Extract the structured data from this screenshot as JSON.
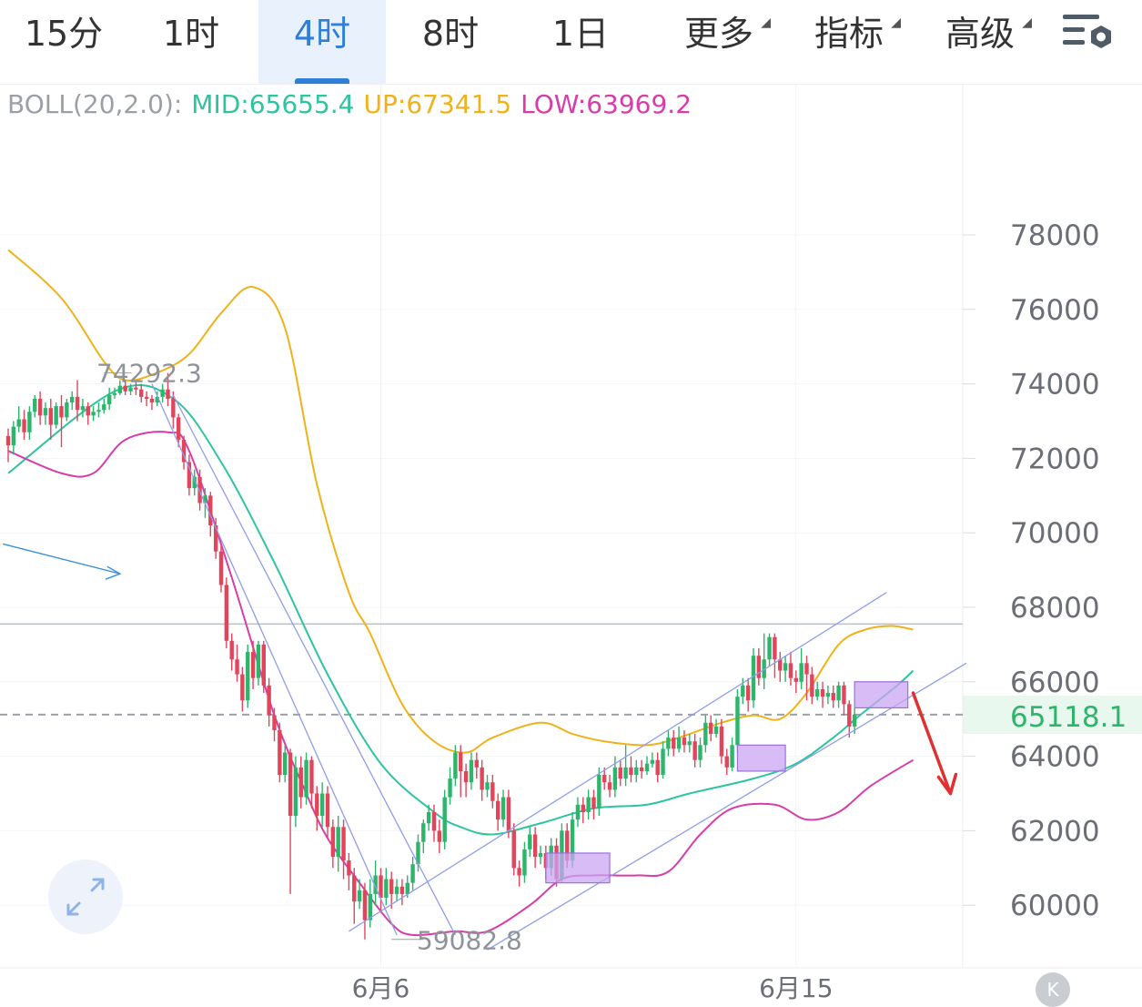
{
  "tabs": [
    {
      "label": "15分"
    },
    {
      "label": "1时"
    },
    {
      "label": "4时",
      "active": true
    },
    {
      "label": "8时"
    },
    {
      "label": "1日"
    },
    {
      "label": "更多"
    },
    {
      "label": "指标"
    },
    {
      "label": "高级"
    }
  ],
  "indicator": {
    "name": "BOLL(20,2.0):",
    "mid": "MID:65655.4",
    "up": "UP:67341.5",
    "low": "LOW:63969.2"
  },
  "colors": {
    "up_candle": "#2cb56b",
    "down_candle": "#e0455c",
    "mid": "#2ec4a0",
    "upper": "#f0b21b",
    "lower": "#d83ca8",
    "accent": "#2f7fd9",
    "trend": "#8f9de8",
    "box": "#c9a6f3",
    "arrow": "#e03131",
    "blue_arrow": "#3a8fd8"
  },
  "icons": {
    "menu": "chart-settings-icon",
    "expand": "expand-icon",
    "scroll": "scroll-to-latest-icon"
  },
  "chart_data": {
    "type": "candlestick",
    "y_ticks": [
      "78000",
      "76000",
      "74000",
      "72000",
      "70000",
      "68000",
      "66000",
      "64000",
      "62000",
      "60000"
    ],
    "y_range": [
      58500,
      79500
    ],
    "x_labels": [
      {
        "text": "6月6",
        "index": 70
      },
      {
        "text": "6月15",
        "index": 148
      }
    ],
    "last_price": "65118.1",
    "high_label": "74292.3",
    "low_label": "59082.8",
    "high_index": 30,
    "low_index": 72,
    "horizontal_level": 67550,
    "candles": [
      [
        72600,
        72350,
        72800,
        71900
      ],
      [
        72350,
        72850,
        73000,
        72100
      ],
      [
        72850,
        73050,
        73400,
        72700
      ],
      [
        73050,
        72700,
        73300,
        72500
      ],
      [
        72700,
        73250,
        73400,
        72500
      ],
      [
        73250,
        73600,
        73700,
        73100
      ],
      [
        73600,
        73150,
        73800,
        72900
      ],
      [
        73150,
        73350,
        73500,
        72900
      ],
      [
        73350,
        72900,
        73600,
        72500
      ],
      [
        72900,
        73400,
        73500,
        72800
      ],
      [
        73400,
        73100,
        73700,
        72300
      ],
      [
        73100,
        73500,
        73600,
        73000
      ],
      [
        73500,
        73650,
        73800,
        73300
      ],
      [
        73650,
        73300,
        74100,
        73000
      ],
      [
        73300,
        73400,
        73600,
        73100
      ],
      [
        73400,
        73150,
        73500,
        72900
      ],
      [
        73150,
        73250,
        73400,
        73000
      ],
      [
        73250,
        73300,
        73500,
        73100
      ],
      [
        73300,
        73450,
        73600,
        73200
      ],
      [
        73450,
        73700,
        73900,
        73300
      ],
      [
        73700,
        73750,
        73900,
        73600
      ],
      [
        73750,
        73950,
        74100,
        73700
      ],
      [
        73950,
        73800,
        74100,
        73700
      ],
      [
        73800,
        73900,
        74000,
        73700
      ],
      [
        73900,
        73850,
        74050,
        73700
      ],
      [
        73850,
        73650,
        74000,
        73500
      ],
      [
        73650,
        73600,
        73800,
        73400
      ],
      [
        73600,
        73500,
        73700,
        73300
      ],
      [
        73500,
        73650,
        73800,
        73400
      ],
      [
        73650,
        73850,
        74000,
        73500
      ],
      [
        73850,
        73600,
        74292,
        73400
      ],
      [
        73600,
        73100,
        73800,
        72800
      ],
      [
        73100,
        72500,
        73200,
        72300
      ],
      [
        72500,
        71900,
        72600,
        71700
      ],
      [
        71900,
        71200,
        72100,
        71000
      ],
      [
        71200,
        71500,
        71700,
        71000
      ],
      [
        71500,
        70800,
        71700,
        70600
      ],
      [
        70800,
        71000,
        71200,
        70400
      ],
      [
        71000,
        70200,
        71100,
        69900
      ],
      [
        70200,
        69500,
        70400,
        69300
      ],
      [
        69500,
        68600,
        69700,
        68400
      ],
      [
        68600,
        67100,
        68800,
        66900
      ],
      [
        67100,
        66600,
        67300,
        66300
      ],
      [
        66600,
        66200,
        67000,
        66000
      ],
      [
        66200,
        65500,
        66400,
        65200
      ],
      [
        65500,
        66800,
        67000,
        65300
      ],
      [
        66800,
        66100,
        67100,
        65800
      ],
      [
        66100,
        67000,
        67100,
        65900
      ],
      [
        67000,
        65900,
        67100,
        65700
      ],
      [
        65900,
        65100,
        66100,
        64800
      ],
      [
        65100,
        64700,
        65300,
        64400
      ],
      [
        64700,
        63500,
        64900,
        63300
      ],
      [
        63500,
        64100,
        64300,
        63300
      ],
      [
        64100,
        62400,
        64200,
        60300
      ],
      [
        62400,
        63700,
        64000,
        62100
      ],
      [
        63700,
        62900,
        64000,
        62600
      ],
      [
        62900,
        63900,
        64100,
        62700
      ],
      [
        63900,
        63000,
        64000,
        62600
      ],
      [
        63000,
        62400,
        63200,
        62000
      ],
      [
        62400,
        63000,
        63300,
        62100
      ],
      [
        63000,
        62100,
        63200,
        61800
      ],
      [
        62100,
        61300,
        62300,
        61000
      ],
      [
        61300,
        62100,
        62400,
        60900
      ],
      [
        62100,
        61200,
        62300,
        60700
      ],
      [
        61200,
        60800,
        61400,
        60400
      ],
      [
        60800,
        60100,
        61000,
        59500
      ],
      [
        60100,
        60400,
        60700,
        59900
      ],
      [
        60400,
        59600,
        60600,
        59082
      ],
      [
        59600,
        60300,
        60700,
        59400
      ],
      [
        60300,
        60800,
        61200,
        60000
      ],
      [
        60800,
        60200,
        61000,
        59800
      ],
      [
        60200,
        60700,
        61000,
        60000
      ],
      [
        60700,
        60300,
        60900,
        59900
      ],
      [
        60300,
        60500,
        60700,
        60100
      ],
      [
        60500,
        60300,
        60700,
        60000
      ],
      [
        60300,
        60600,
        60800,
        60200
      ],
      [
        60600,
        61100,
        61300,
        60400
      ],
      [
        61100,
        61700,
        61900,
        60900
      ],
      [
        61700,
        62200,
        62300,
        61400
      ],
      [
        62200,
        62500,
        62700,
        62000
      ],
      [
        62500,
        62000,
        62700,
        61700
      ],
      [
        62000,
        61700,
        62300,
        61400
      ],
      [
        61700,
        62900,
        63100,
        61500
      ],
      [
        62900,
        63400,
        63700,
        62700
      ],
      [
        63400,
        64100,
        64300,
        63200
      ],
      [
        64100,
        63600,
        64300,
        62900
      ],
      [
        63600,
        63300,
        63800,
        62900
      ],
      [
        63300,
        63900,
        64100,
        63100
      ],
      [
        63900,
        63700,
        64100,
        63400
      ],
      [
        63700,
        63100,
        63900,
        62800
      ],
      [
        63100,
        63300,
        63500,
        62900
      ],
      [
        63300,
        62800,
        63500,
        62600
      ],
      [
        62800,
        62300,
        63000,
        62000
      ],
      [
        62300,
        62900,
        63100,
        62100
      ],
      [
        62900,
        62000,
        63100,
        61800
      ],
      [
        62000,
        61000,
        62200,
        60800
      ],
      [
        61000,
        60800,
        61200,
        60500
      ],
      [
        60800,
        61500,
        61700,
        60600
      ],
      [
        61500,
        61900,
        62100,
        61300
      ],
      [
        61900,
        61300,
        62100,
        61000
      ],
      [
        61300,
        61400,
        61600,
        61100
      ],
      [
        61400,
        61000,
        61600,
        60700
      ],
      [
        61000,
        61600,
        61800,
        60800
      ],
      [
        61600,
        60700,
        61800,
        60500
      ],
      [
        60700,
        62000,
        62200,
        60600
      ],
      [
        62000,
        61200,
        62200,
        61000
      ],
      [
        61200,
        62300,
        62500,
        61000
      ],
      [
        62300,
        62700,
        62900,
        62100
      ],
      [
        62700,
        62500,
        62900,
        62200
      ],
      [
        62500,
        62900,
        63100,
        62300
      ],
      [
        62900,
        62600,
        63100,
        62300
      ],
      [
        62600,
        63500,
        63700,
        62400
      ],
      [
        63500,
        63300,
        63700,
        63100
      ],
      [
        63300,
        63100,
        63500,
        62900
      ],
      [
        63100,
        63700,
        64000,
        62900
      ],
      [
        63700,
        63400,
        63900,
        63200
      ],
      [
        63400,
        63700,
        64300,
        63200
      ],
      [
        63700,
        63500,
        64000,
        63300
      ],
      [
        63500,
        63700,
        63900,
        63300
      ],
      [
        63700,
        63600,
        63900,
        63400
      ],
      [
        63600,
        63800,
        64000,
        63500
      ],
      [
        63800,
        63900,
        64100,
        63700
      ],
      [
        63900,
        63500,
        64100,
        63300
      ],
      [
        63500,
        64200,
        64400,
        63400
      ],
      [
        64200,
        64500,
        64700,
        64000
      ],
      [
        64500,
        64200,
        64700,
        64000
      ],
      [
        64200,
        64500,
        64800,
        64100
      ],
      [
        64500,
        64300,
        64700,
        64100
      ],
      [
        64300,
        64400,
        64600,
        64100
      ],
      [
        64400,
        63900,
        64600,
        63700
      ],
      [
        63900,
        64300,
        64500,
        63700
      ],
      [
        64300,
        64900,
        65100,
        64100
      ],
      [
        64900,
        64600,
        65100,
        64400
      ],
      [
        64600,
        64800,
        65000,
        64500
      ],
      [
        64800,
        64000,
        65000,
        63800
      ],
      [
        64000,
        63700,
        64200,
        63500
      ],
      [
        63700,
        64300,
        64500,
        63600
      ],
      [
        64300,
        65600,
        65800,
        64100
      ],
      [
        65600,
        65900,
        66100,
        65400
      ],
      [
        65900,
        65500,
        66100,
        65200
      ],
      [
        65500,
        66700,
        66900,
        65300
      ],
      [
        66700,
        66100,
        66900,
        65900
      ],
      [
        66100,
        66600,
        67300,
        65800
      ],
      [
        66600,
        67200,
        67300,
        66400
      ],
      [
        67200,
        66600,
        67300,
        66100
      ],
      [
        66600,
        66300,
        66800,
        66000
      ],
      [
        66300,
        66500,
        66700,
        66000
      ],
      [
        66500,
        66100,
        66800,
        65900
      ],
      [
        66100,
        66000,
        66300,
        65700
      ],
      [
        66000,
        66500,
        66900,
        65800
      ],
      [
        66500,
        66200,
        66700,
        65500
      ],
      [
        66200,
        65600,
        66400,
        65400
      ],
      [
        65600,
        65800,
        66000,
        65500
      ],
      [
        65800,
        65600,
        66000,
        65300
      ],
      [
        65600,
        65700,
        65900,
        65400
      ],
      [
        65700,
        65500,
        65900,
        65300
      ],
      [
        65500,
        65900,
        66000,
        65300
      ],
      [
        65900,
        65400,
        66000,
        65100
      ],
      [
        65400,
        64800,
        65500,
        64500
      ],
      [
        64800,
        65118,
        65300,
        64600
      ]
    ],
    "bands": {
      "mid_knots": [
        [
          0,
          71600
        ],
        [
          20,
          73800
        ],
        [
          31,
          73600
        ],
        [
          40,
          71900
        ],
        [
          50,
          69200
        ],
        [
          60,
          66200
        ],
        [
          70,
          63800
        ],
        [
          80,
          62500
        ],
        [
          85,
          62100
        ],
        [
          91,
          61900
        ],
        [
          100,
          62200
        ],
        [
          110,
          62600
        ],
        [
          120,
          62700
        ],
        [
          128,
          63000
        ],
        [
          140,
          63400
        ],
        [
          148,
          63800
        ],
        [
          155,
          64500
        ],
        [
          160,
          65100
        ],
        [
          167,
          65900
        ],
        [
          170,
          66300
        ]
      ],
      "upper_knots": [
        [
          0,
          77600
        ],
        [
          10,
          76300
        ],
        [
          18,
          74600
        ],
        [
          22,
          74100
        ],
        [
          28,
          74300
        ],
        [
          34,
          74800
        ],
        [
          40,
          75900
        ],
        [
          46,
          76600
        ],
        [
          52,
          75500
        ],
        [
          58,
          71300
        ],
        [
          64,
          68400
        ],
        [
          68,
          67300
        ],
        [
          74,
          65400
        ],
        [
          80,
          64400
        ],
        [
          86,
          64100
        ],
        [
          91,
          64500
        ],
        [
          100,
          64900
        ],
        [
          106,
          64600
        ],
        [
          112,
          64400
        ],
        [
          120,
          64300
        ],
        [
          126,
          64500
        ],
        [
          134,
          64900
        ],
        [
          140,
          65100
        ],
        [
          145,
          65000
        ],
        [
          150,
          65700
        ],
        [
          156,
          67000
        ],
        [
          161,
          67400
        ],
        [
          166,
          67500
        ],
        [
          170,
          67400
        ]
      ],
      "lower_knots": [
        [
          0,
          72200
        ],
        [
          10,
          71600
        ],
        [
          16,
          71600
        ],
        [
          22,
          72500
        ],
        [
          30,
          72700
        ],
        [
          34,
          72200
        ],
        [
          42,
          68800
        ],
        [
          50,
          65100
        ],
        [
          56,
          63000
        ],
        [
          60,
          61800
        ],
        [
          66,
          60600
        ],
        [
          72,
          59500
        ],
        [
          76,
          59200
        ],
        [
          84,
          59300
        ],
        [
          90,
          59300
        ],
        [
          98,
          60000
        ],
        [
          104,
          60700
        ],
        [
          110,
          60800
        ],
        [
          118,
          60800
        ],
        [
          124,
          60900
        ],
        [
          130,
          61900
        ],
        [
          136,
          62600
        ],
        [
          144,
          62700
        ],
        [
          150,
          62300
        ],
        [
          156,
          62500
        ],
        [
          162,
          63200
        ],
        [
          170,
          63900
        ]
      ]
    },
    "trend_lines": [
      {
        "from": [
          27,
          74000
        ],
        "to": [
          73,
          59200
        ]
      },
      {
        "from": [
          31,
          73700
        ],
        "to": [
          84,
          59200
        ]
      },
      {
        "from": [
          64,
          59300
        ],
        "to": [
          165,
          68400
        ]
      },
      {
        "from": [
          90,
          58800
        ],
        "to": [
          180,
          66500
        ]
      }
    ],
    "boxes": [
      {
        "from": 101,
        "to": 113,
        "top": 61400,
        "bottom": 60600
      },
      {
        "from": 137,
        "to": 146,
        "top": 64300,
        "bottom": 63600
      },
      {
        "from": 159,
        "to": 169,
        "top": 66000,
        "bottom": 65300
      }
    ],
    "forecast_arrow": {
      "from": [
        170,
        65700
      ],
      "to": [
        177,
        63000
      ]
    },
    "side_arrow": {
      "from": [
        -1,
        69700
      ],
      "to": [
        21,
        68900
      ]
    }
  }
}
